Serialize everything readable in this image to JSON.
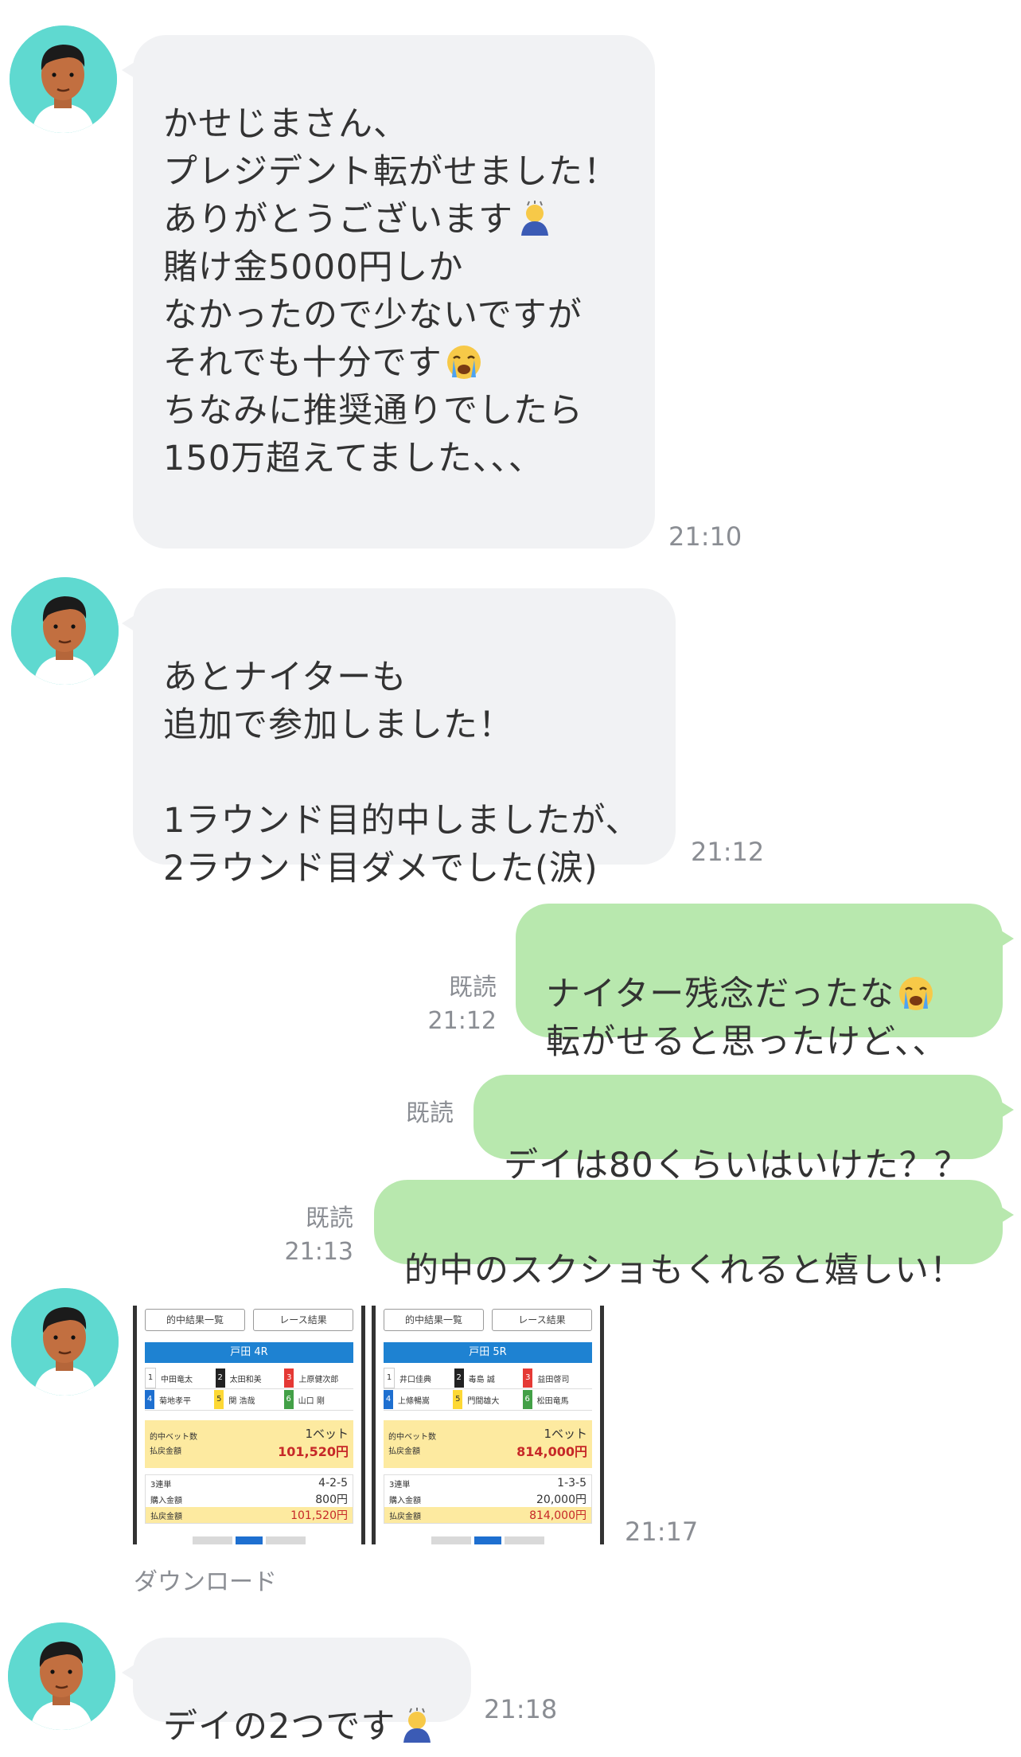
{
  "messages": [
    {
      "id": "m1",
      "side": "in",
      "text": "かせじまさん、\nプレジデント転がせました！\nありがとうございます",
      "text2": "\n賭け金5000円しか\nなかったので少ないですが\nそれでも十分です",
      "text3": "\nちなみに推奨通りでしたら\n150万超えてました、、、",
      "time": "21:10"
    },
    {
      "id": "m2",
      "side": "in",
      "text": "あとナイターも\n追加で参加しました！\n\n1ラウンド目的中しましたが、\n2ラウンド目ダメでした(涙)",
      "time": "21:12"
    },
    {
      "id": "m3",
      "side": "out",
      "text": "ナイター残念だったな",
      "text2": "転がせると思ったけど、、",
      "read": "既読",
      "time": "21:12"
    },
    {
      "id": "m4",
      "side": "out",
      "text": "デイは80くらいはいけた？？",
      "read": "既読",
      "time": ""
    },
    {
      "id": "m5",
      "side": "out",
      "text": "的中のスクショもくれると嬉しい！",
      "read": "既読",
      "time": "21:13"
    },
    {
      "id": "m6",
      "side": "in",
      "time": "21:17",
      "download": "ダウンロード"
    },
    {
      "id": "m7",
      "side": "in",
      "text": "デイの2つです",
      "time": "21:18"
    }
  ],
  "screenshots": [
    {
      "btn_left": "的中結果一覧",
      "btn_right": "レース結果",
      "venue": "戸田 4R",
      "racers": [
        [
          "1",
          "中田竜太",
          "2",
          "太田和美",
          "3",
          "上原健次郎"
        ],
        [
          "4",
          "菊地孝平",
          "5",
          "関 浩哉",
          "6",
          "山口 剛"
        ]
      ],
      "hit_label": "的中ベット数",
      "pay_label": "払戻金額",
      "bets": "1ベット",
      "payout": "101,520円",
      "bet_type": "3連単",
      "combo": "4-2-5",
      "buy_label": "購入金額",
      "buy": "800円",
      "total_label": "払戻金額",
      "total": "101,520円"
    },
    {
      "btn_left": "的中結果一覧",
      "btn_right": "レース結果",
      "venue": "戸田 5R",
      "racers": [
        [
          "1",
          "井口佳典",
          "2",
          "毒島 誠",
          "3",
          "益田啓司"
        ],
        [
          "4",
          "上條暢嵩",
          "5",
          "門間雄大",
          "6",
          "松田竜馬"
        ]
      ],
      "hit_label": "的中ベット数",
      "pay_label": "払戻金額",
      "bets": "1ベット",
      "payout": "814,000円",
      "bet_type": "3連単",
      "combo": "1-3-5",
      "buy_label": "購入金額",
      "buy": "20,000円",
      "total_label": "払戻金額",
      "total": "814,000円"
    }
  ],
  "colors": {
    "incoming_bubble": "#f1f2f4",
    "outgoing_bubble": "#b8e8ae",
    "avatar_bg": "#5fd9d0",
    "time": "#8a8d93"
  }
}
